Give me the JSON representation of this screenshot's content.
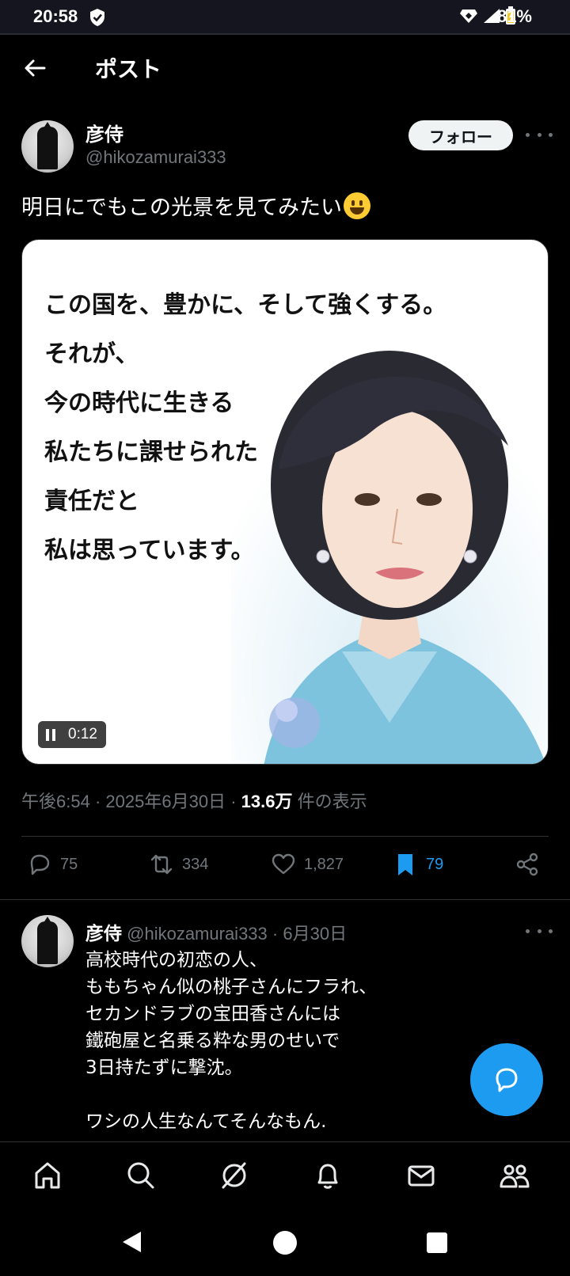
{
  "status_bar": {
    "time": "20:58",
    "battery": "81%"
  },
  "header": {
    "title": "ポスト"
  },
  "post": {
    "author_name": "彦侍",
    "author_handle": "@hikozamurai333",
    "follow_label": "フォロー",
    "text": "明日にでもこの光景を見てみたい",
    "media": {
      "quote_lines": [
        "この国を、豊かに、そして強くする。",
        "それが、",
        "今の時代に生きる",
        "私たちに課せられた",
        "責任だと",
        "私は思っています。"
      ],
      "video_time": "0:12"
    },
    "meta": {
      "time": "午後6:54",
      "date": "2025年6月30日",
      "views": "13.6万",
      "views_suffix": "件の表示"
    },
    "actions": {
      "replies": "75",
      "reposts": "334",
      "likes": "1,827",
      "bookmarks": "79"
    }
  },
  "reply": {
    "author_name": "彦侍",
    "author_handle": "@hikozamurai333",
    "date": "6月30日",
    "lines": [
      "高校時代の初恋の人、",
      "ももちゃん似の桃子さんにフラれ、",
      "セカンドラブの宝田香さんには",
      "鐵砲屋と名乗る粋な男のせいで",
      "3日持たずに撃沈。",
      "",
      "ワシの人生なんてそんなもん."
    ]
  },
  "colors": {
    "accent": "#1d9bf0",
    "background": "#000000",
    "secondary_text": "#71767b"
  }
}
